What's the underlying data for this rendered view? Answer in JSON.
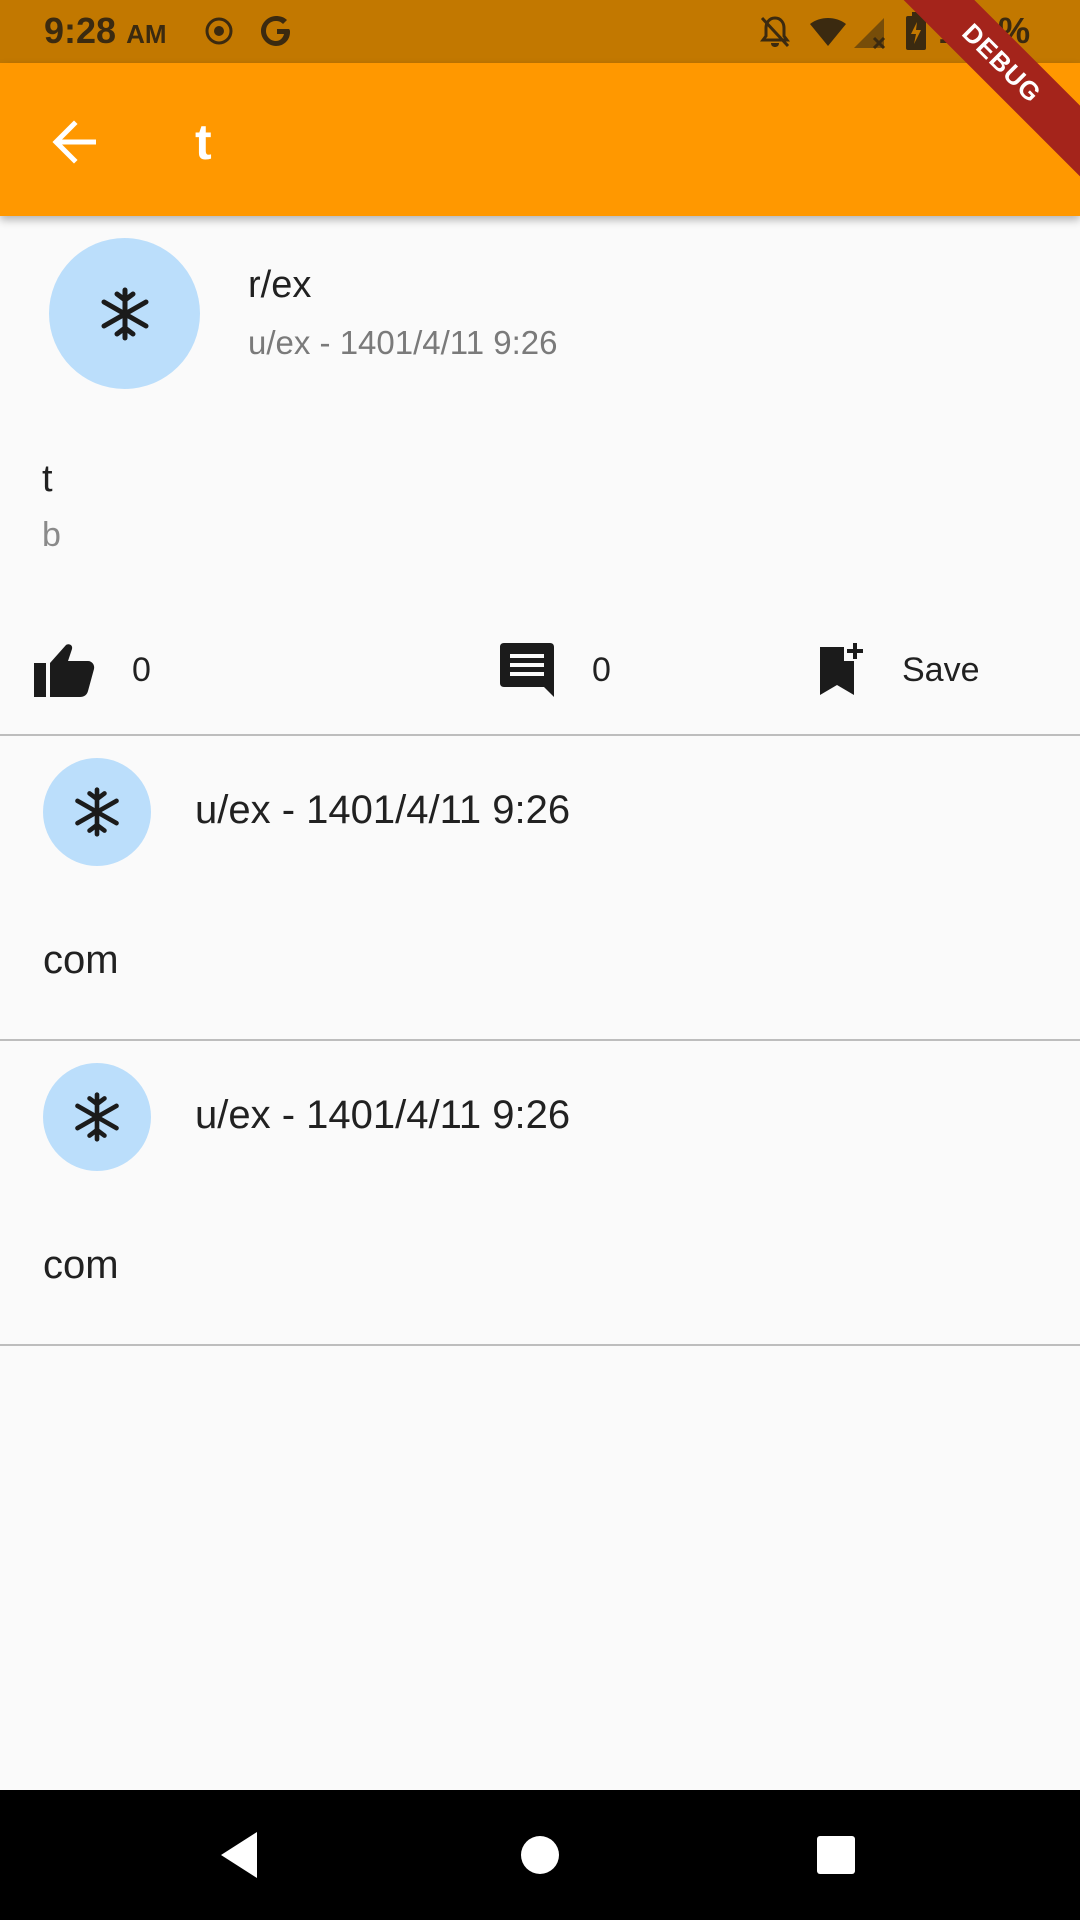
{
  "status_bar": {
    "time": "9:28",
    "ampm": "AM",
    "battery": "100%",
    "icons": [
      "location-icon",
      "google-icon",
      "notifications-off-icon",
      "wifi-icon",
      "signal-icon",
      "battery-charging-icon"
    ]
  },
  "debug_banner": "DEBUG",
  "app_bar": {
    "title": "t",
    "background": "#ff9800"
  },
  "post": {
    "subreddit": "r/ex",
    "meta": "u/ex - 1401/4/11 9:26",
    "title": "t",
    "body": "b",
    "avatar_icon": "snowflake-icon",
    "actions": {
      "like_count": "0",
      "comment_count": "0",
      "save_label": "Save"
    }
  },
  "comments": [
    {
      "meta": "u/ex - 1401/4/11 9:26",
      "text": "com",
      "avatar_icon": "snowflake-icon"
    },
    {
      "meta": "u/ex - 1401/4/11 9:26",
      "text": "com",
      "avatar_icon": "snowflake-icon"
    }
  ],
  "colors": {
    "status_bar": "#c27800",
    "avatar_bg": "#bbdefb",
    "debug_ribbon": "#a4241b"
  }
}
